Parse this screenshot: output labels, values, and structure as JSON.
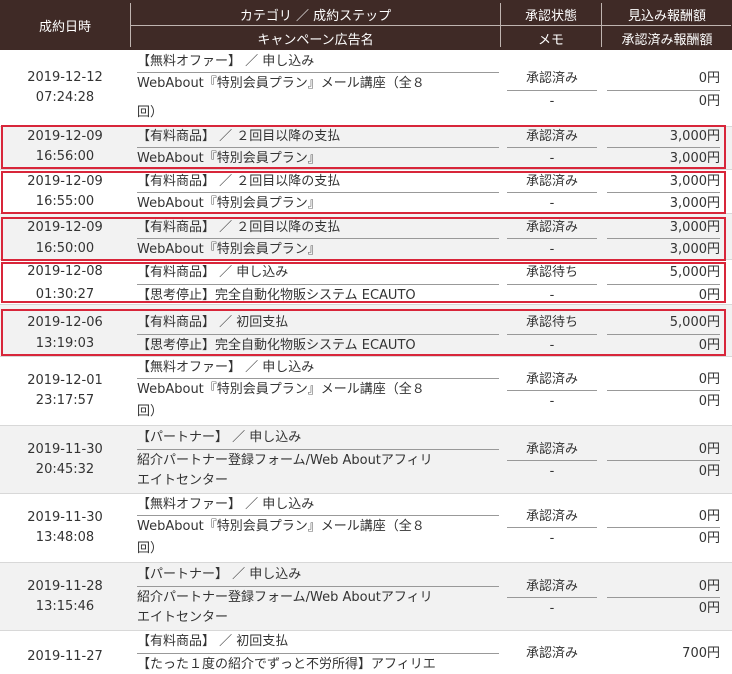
{
  "header": {
    "date": "成約日時",
    "category": "カテゴリ ／ 成約ステップ",
    "campaign": "キャンペーン広告名",
    "status": "承認状態",
    "memo": "メモ",
    "expected": "見込み報酬額",
    "approved": "承認済み報酬額"
  },
  "rows": [
    {
      "date": "2019-12-12",
      "time": "07:24:28",
      "category": "【無料オファー】 ／ 申し込み",
      "campaign_line1": "WebAbout『特別会員プラン』メール講座（全８",
      "campaign_line2": "回）",
      "status": "承認済み",
      "memo": "-",
      "expected": "0円",
      "approved": "0円"
    },
    {
      "date": "2019-12-09",
      "time": "16:56:00",
      "category": "【有料商品】 ／ ２回目以降の支払",
      "campaign_line1": "WebAbout『特別会員プラン』",
      "campaign_line2": "",
      "status": "承認済み",
      "memo": "-",
      "expected": "3,000円",
      "approved": "3,000円"
    },
    {
      "date": "2019-12-09",
      "time": "16:55:00",
      "category": "【有料商品】 ／ ２回目以降の支払",
      "campaign_line1": "WebAbout『特別会員プラン』",
      "campaign_line2": "",
      "status": "承認済み",
      "memo": "-",
      "expected": "3,000円",
      "approved": "3,000円"
    },
    {
      "date": "2019-12-09",
      "time": "16:50:00",
      "category": "【有料商品】 ／ ２回目以降の支払",
      "campaign_line1": "WebAbout『特別会員プラン』",
      "campaign_line2": "",
      "status": "承認済み",
      "memo": "-",
      "expected": "3,000円",
      "approved": "3,000円"
    },
    {
      "date": "2019-12-08",
      "time": "01:30:27",
      "category": "【有料商品】 ／ 申し込み",
      "campaign_line1": "【思考停止】完全自動化物販システム ECAUTO",
      "campaign_line2": "",
      "status": "承認待ち",
      "memo": "-",
      "expected": "5,000円",
      "approved": "0円"
    },
    {
      "date": "2019-12-06",
      "time": "13:19:03",
      "category": "【有料商品】 ／ 初回支払",
      "campaign_line1": "【思考停止】完全自動化物販システム ECAUTO",
      "campaign_line2": "",
      "status": "承認待ち",
      "memo": "-",
      "expected": "5,000円",
      "approved": "0円"
    },
    {
      "date": "2019-12-01",
      "time": "23:17:57",
      "category": "【無料オファー】 ／ 申し込み",
      "campaign_line1": "WebAbout『特別会員プラン』メール講座（全８",
      "campaign_line2": "回）",
      "status": "承認済み",
      "memo": "-",
      "expected": "0円",
      "approved": "0円"
    },
    {
      "date": "2019-11-30",
      "time": "20:45:32",
      "category": "【パートナー】 ／ 申し込み",
      "campaign_line1": "紹介パートナー登録フォーム/Web Aboutアフィリ",
      "campaign_line2": "エイトセンター",
      "status": "承認済み",
      "memo": "-",
      "expected": "0円",
      "approved": "0円"
    },
    {
      "date": "2019-11-30",
      "time": "13:48:08",
      "category": "【無料オファー】 ／ 申し込み",
      "campaign_line1": "WebAbout『特別会員プラン』メール講座（全８",
      "campaign_line2": "回）",
      "status": "承認済み",
      "memo": "-",
      "expected": "0円",
      "approved": "0円"
    },
    {
      "date": "2019-11-28",
      "time": "13:15:46",
      "category": "【パートナー】 ／ 申し込み",
      "campaign_line1": "紹介パートナー登録フォーム/Web Aboutアフィリ",
      "campaign_line2": "エイトセンター",
      "status": "承認済み",
      "memo": "-",
      "expected": "0円",
      "approved": "0円"
    },
    {
      "date": "2019-11-27",
      "time": "",
      "category": "【有料商品】 ／ 初回支払",
      "campaign_line1": "【たった１度の紹介でずっと不労所得】アフィリエ",
      "campaign_line2": "",
      "status": "承認済み",
      "memo": "",
      "expected": "700円",
      "approved": ""
    }
  ],
  "highlight_color": "#d8263a",
  "header_color": "#3f2a26"
}
